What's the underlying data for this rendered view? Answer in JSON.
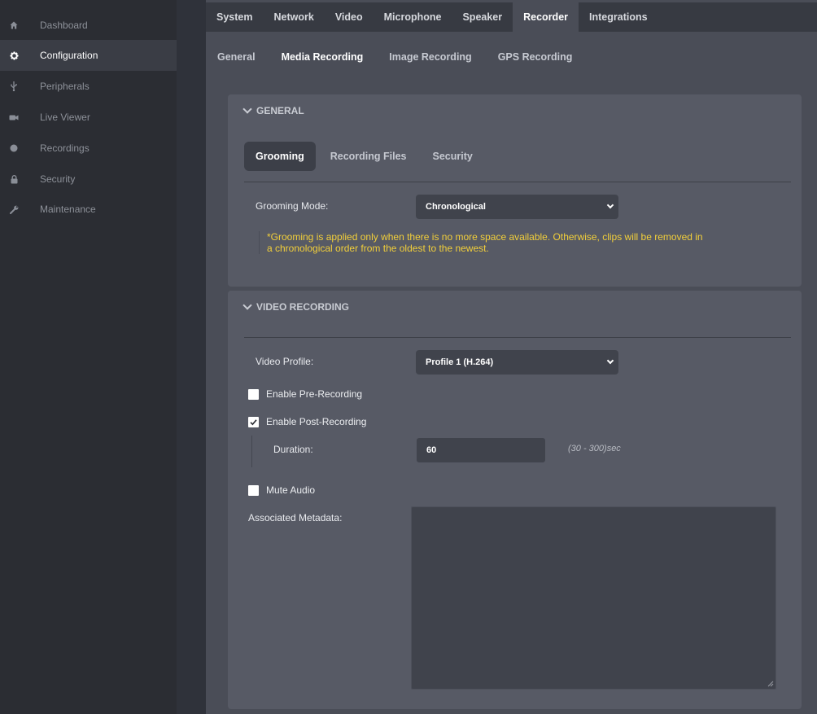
{
  "sidebar": {
    "items": [
      {
        "label": "Dashboard",
        "icon": "home-icon"
      },
      {
        "label": "Configuration",
        "icon": "gear-icon"
      },
      {
        "label": "Peripherals",
        "icon": "usb-icon"
      },
      {
        "label": "Live Viewer",
        "icon": "camera-icon"
      },
      {
        "label": "Recordings",
        "icon": "record-icon"
      },
      {
        "label": "Security",
        "icon": "lock-icon"
      },
      {
        "label": "Maintenance",
        "icon": "wrench-icon"
      }
    ],
    "active": "Configuration"
  },
  "topnav": {
    "tabs": [
      "System",
      "Network",
      "Video",
      "Microphone",
      "Speaker",
      "Recorder",
      "Integrations"
    ],
    "active": "Recorder"
  },
  "subnav": {
    "tabs": [
      "General",
      "Media Recording",
      "Image Recording",
      "GPS Recording"
    ],
    "active": "Media Recording"
  },
  "general_section": {
    "title": "GENERAL",
    "tabs": [
      "Grooming",
      "Recording Files",
      "Security"
    ],
    "active_tab": "Grooming",
    "grooming_mode_label": "Grooming Mode:",
    "grooming_mode_value": "Chronological",
    "note_line1": "*Grooming is applied only when there is no more space available. Otherwise, clips will be removed in",
    "note_line2": "a chronological order from the oldest to the newest."
  },
  "video_section": {
    "title": "VIDEO RECORDING",
    "video_profile_label": "Video Profile:",
    "video_profile_value": "Profile 1 (H.264)",
    "pre_recording_label": "Enable Pre-Recording",
    "pre_recording_checked": false,
    "post_recording_label": "Enable Post-Recording",
    "post_recording_checked": true,
    "duration_label": "Duration:",
    "duration_value": "60",
    "duration_hint": "(30 - 300)sec",
    "mute_audio_label": "Mute Audio",
    "mute_audio_checked": false,
    "metadata_label": "Associated Metadata:",
    "metadata_value": ""
  },
  "colors": {
    "accent_note": "#f2cf3a",
    "panel": "#575a65",
    "main": "#4a4d57",
    "sidebar": "#2b2d33"
  }
}
